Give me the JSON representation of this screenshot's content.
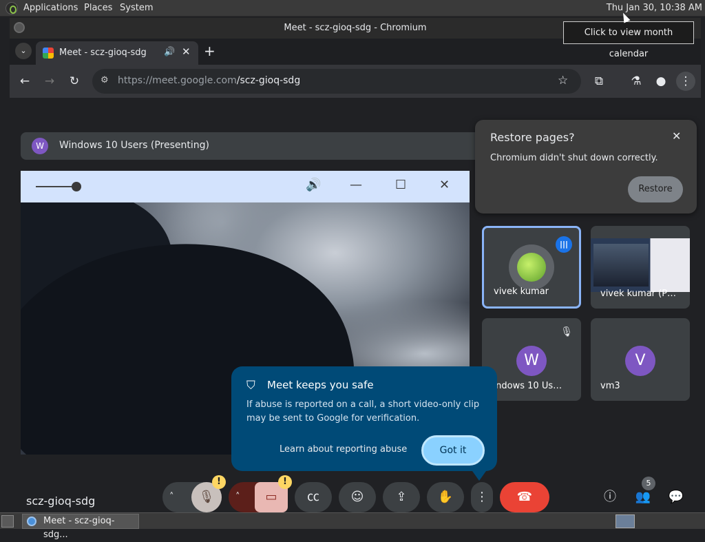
{
  "system_panel": {
    "menus": [
      "Applications",
      "Places",
      "System"
    ],
    "clock": "Thu Jan 30, 10:38 AM",
    "tooltip": "Click to view month calendar"
  },
  "browser": {
    "window_title": "Meet - scz-gioq-sdg - Chromium",
    "tab_title": "Meet - scz-gioq-sdg",
    "url_domain": "https://meet.google.com",
    "url_path": "/scz-gioq-sdg",
    "new_tab_label": "+"
  },
  "restore_popup": {
    "title": "Restore pages?",
    "message": "Chromium didn't shut down correctly.",
    "button": "Restore"
  },
  "presenting": {
    "avatar_letter": "W",
    "label": "Windows 10 Users (Presenting)"
  },
  "participants": [
    {
      "name": "vivek kumar",
      "speaking": true
    },
    {
      "name": "vivek kumar (P…"
    },
    {
      "name": "Windows 10 Us…",
      "avatar_letter": "W",
      "muted": true
    },
    {
      "name": "vm3",
      "avatar_letter": "V"
    }
  ],
  "safety_card": {
    "title": "Meet keeps you safe",
    "body": "If abuse is reported on a call, a short video-only clip may be sent to Google for verification.",
    "link": "Learn about reporting abuse",
    "button": "Got it"
  },
  "controls": {
    "meeting_code": "scz-gioq-sdg",
    "warning_badge": "!",
    "people_count": "5"
  },
  "taskbar": {
    "window_item": "Meet - scz-gioq-sdg..."
  },
  "colors": {
    "end_call": "#ea4335",
    "safety_card_bg": "#004a77",
    "active_tile_border": "#8ab4f8"
  }
}
